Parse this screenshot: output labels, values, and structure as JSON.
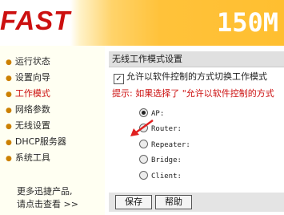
{
  "header": {
    "logo": "FAST",
    "model": "150M"
  },
  "sidebar": {
    "items": [
      {
        "label": "运行状态"
      },
      {
        "label": "设置向导"
      },
      {
        "label": "工作模式",
        "active": true
      },
      {
        "label": "网络参数"
      },
      {
        "label": "无线设置"
      },
      {
        "label": "DHCP服务器"
      },
      {
        "label": "系统工具"
      }
    ],
    "more_line1": "更多迅捷产品,",
    "more_line2": "请点击查看 >>"
  },
  "main": {
    "title": "无线工作模式设置",
    "checkbox_label": "允许以软件控制的方式切换工作模式",
    "checkbox_checked": true,
    "hint": "提示: 如果选择了 \"允许以软件控制的方式",
    "modes": [
      {
        "label": "AP:",
        "selected": true
      },
      {
        "label": "Router:",
        "selected": false
      },
      {
        "label": "Repeater:",
        "selected": false
      },
      {
        "label": "Bridge:",
        "selected": false
      },
      {
        "label": "Client:",
        "selected": false
      }
    ],
    "save_label": "保存",
    "help_label": "帮助"
  },
  "colors": {
    "logo_red": "#cc1010",
    "header_orange": "#ffc23a",
    "hint_red": "#cc1010",
    "arrow_red": "#e02020"
  }
}
